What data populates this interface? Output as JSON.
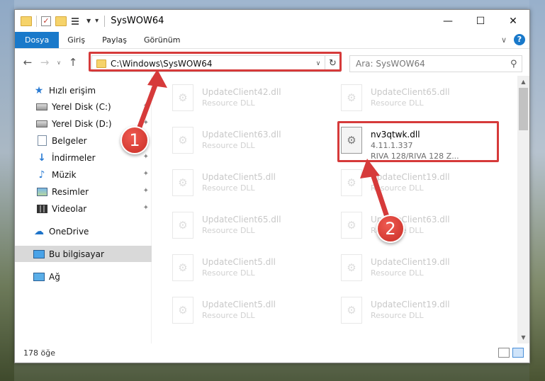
{
  "window": {
    "title": "SysWOW64",
    "controls": {
      "minimize": "—",
      "maximize": "☐",
      "close": "✕"
    }
  },
  "ribbon": {
    "tabs": [
      {
        "label": "Dosya",
        "active": true
      },
      {
        "label": "Giriş"
      },
      {
        "label": "Paylaş"
      },
      {
        "label": "Görünüm"
      }
    ],
    "help": "?"
  },
  "address": {
    "path": "C:\\Windows\\SysWOW64",
    "search_placeholder": "Ara: SysWOW64"
  },
  "sidebar": {
    "items": [
      {
        "label": "Hızlı erişim",
        "icon": "star-icon"
      },
      {
        "label": "Yerel Disk (C:)",
        "icon": "disk-icon",
        "pinned": true
      },
      {
        "label": "Yerel Disk (D:)",
        "icon": "disk-icon",
        "pinned": true
      },
      {
        "label": "Belgeler",
        "icon": "documents-icon",
        "pinned": true
      },
      {
        "label": "İndirmeler",
        "icon": "downloads-icon",
        "pinned": true
      },
      {
        "label": "Müzik",
        "icon": "music-icon",
        "pinned": true
      },
      {
        "label": "Resimler",
        "icon": "pictures-icon",
        "pinned": true
      },
      {
        "label": "Videolar",
        "icon": "videos-icon",
        "pinned": true
      },
      {
        "label": "OneDrive",
        "icon": "onedrive-icon"
      },
      {
        "label": "Bu bilgisayar",
        "icon": "computer-icon",
        "selected": true
      },
      {
        "label": "Ağ",
        "icon": "network-icon"
      }
    ]
  },
  "files": [
    {
      "name": "UpdateClient42.dll",
      "sub1": "Resource DLL",
      "col": 0,
      "row": 0
    },
    {
      "name": "UpdateClient65.dll",
      "sub1": "Resource DLL",
      "col": 1,
      "row": 0
    },
    {
      "name": "UpdateClient63.dll",
      "sub1": "Resource DLL",
      "col": 0,
      "row": 1
    },
    {
      "name": "nv3qtwk.dll",
      "sub1": "4.11.1.337",
      "sub2": "RIVA 128/RIVA 128 Z...",
      "col": 1,
      "row": 1,
      "highlight": true
    },
    {
      "name": "UpdateClient5.dll",
      "sub1": "Resource DLL",
      "col": 0,
      "row": 2
    },
    {
      "name": "UpdateClient19.dll",
      "sub1": "Resource DLL",
      "col": 1,
      "row": 2
    },
    {
      "name": "UpdateClient65.dll",
      "sub1": "Resource DLL",
      "col": 0,
      "row": 3
    },
    {
      "name": "UpdateClient63.dll",
      "sub1": "Resource DLL",
      "col": 1,
      "row": 3
    },
    {
      "name": "UpdateClient5.dll",
      "sub1": "Resource DLL",
      "col": 0,
      "row": 4
    },
    {
      "name": "UpdateClient19.dll",
      "sub1": "Resource DLL",
      "col": 1,
      "row": 4
    },
    {
      "name": "UpdateClient5.dll",
      "sub1": "Resource DLL",
      "col": 0,
      "row": 5
    },
    {
      "name": "UpdateClient19.dll",
      "sub1": "Resource DLL",
      "col": 1,
      "row": 5
    }
  ],
  "status": {
    "count": "178 öğe"
  },
  "annotations": {
    "step1": "1",
    "step2": "2",
    "color": "#d63a3a"
  }
}
